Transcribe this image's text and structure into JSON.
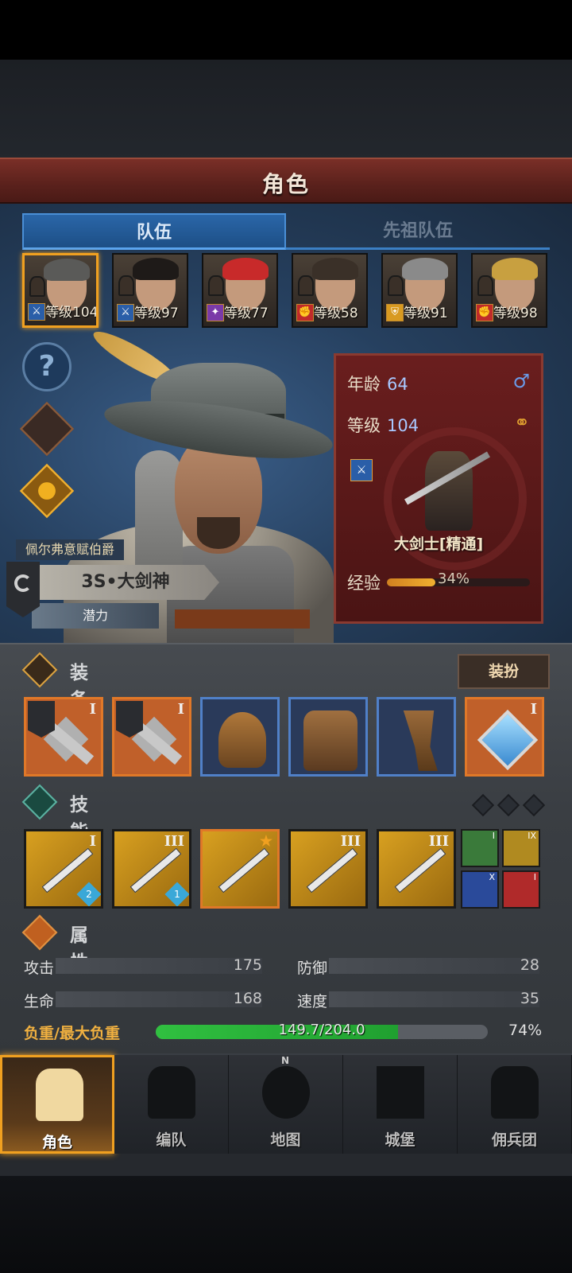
{
  "header": {
    "title": "角色"
  },
  "tabs": [
    {
      "label": "队伍"
    },
    {
      "label": "先祖队伍"
    }
  ],
  "roster": [
    {
      "level": "等级104",
      "hair": "#5a5a58",
      "class_icon": "⚔"
    },
    {
      "level": "等级97",
      "hair": "#1e1a18",
      "class_icon": "⚔"
    },
    {
      "level": "等级77",
      "hair": "#c82a2a",
      "class_icon": "✦"
    },
    {
      "level": "等级58",
      "hair": "#3a3028",
      "class_icon": "✊"
    },
    {
      "level": "等级91",
      "hair": "#8a8a8a",
      "class_icon": "⛨"
    },
    {
      "level": "等级98",
      "hair": "#c8a040",
      "class_icon": "✊"
    }
  ],
  "side": {
    "help": "?"
  },
  "hero": {
    "name": "佩尔弗意赋伯爵",
    "rank": "3S•大剑神",
    "potential_label": "潜力"
  },
  "info": {
    "age_label": "年龄",
    "age_value": "64",
    "gender_symbol": "♂",
    "level_label": "等级",
    "level_value": "104",
    "ring_symbol": "⚭",
    "class_name": "大剑士[精通]",
    "exp_label": "经验",
    "exp_value": "34%",
    "exp_fraction": 0.34
  },
  "equipment": {
    "label": "装备",
    "dress_button": "装扮",
    "slots": [
      {
        "name": "great-sword-1",
        "tier": "I"
      },
      {
        "name": "great-sword-2",
        "tier": "I"
      },
      {
        "name": "helmet",
        "tier": ""
      },
      {
        "name": "chest-armor",
        "tier": ""
      },
      {
        "name": "boots",
        "tier": ""
      },
      {
        "name": "amulet",
        "tier": "I"
      }
    ]
  },
  "skills": {
    "label": "技能",
    "items": [
      {
        "tier": "I",
        "badge": "2"
      },
      {
        "tier": "III",
        "badge": "1"
      },
      {
        "tier": "★",
        "badge": ""
      },
      {
        "tier": "III",
        "badge": ""
      },
      {
        "tier": "III",
        "badge": ""
      }
    ],
    "mini": [
      {
        "tier": "I",
        "color": "#3a7a3a"
      },
      {
        "tier": "IX",
        "color": "#b08a20"
      },
      {
        "tier": "X",
        "color": "#2a4a9a"
      },
      {
        "tier": "I",
        "color": "#b02a2a"
      }
    ]
  },
  "attributes": {
    "label": "属性",
    "attack_label": "攻击",
    "attack_value": "175",
    "defense_label": "防御",
    "defense_value": "28",
    "hp_label": "生命",
    "hp_value": "168",
    "speed_label": "速度",
    "speed_value": "35",
    "load_label": "负重/最大负重",
    "load_value": "149.7/204.0",
    "load_pct": "74%",
    "load_fraction": 0.73
  },
  "nav": [
    {
      "label": "角色"
    },
    {
      "label": "编队"
    },
    {
      "label": "地图"
    },
    {
      "label": "城堡"
    },
    {
      "label": "佣兵团"
    }
  ],
  "nav_compass_letter": "N",
  "colors": {
    "accent": "#f0a020",
    "title_bar": "#6a271f",
    "panel_blue": "#2a4668"
  }
}
